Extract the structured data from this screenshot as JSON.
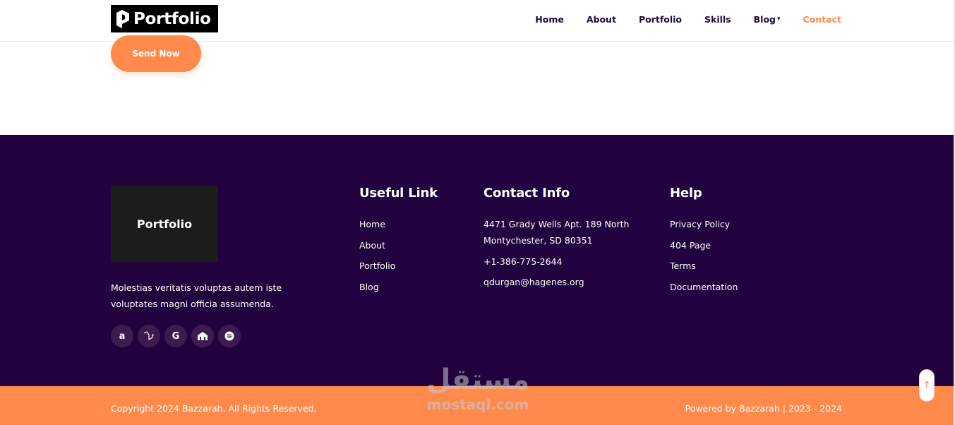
{
  "header": {
    "logo_text": "Portfolio",
    "nav": [
      {
        "label": "Home"
      },
      {
        "label": "About"
      },
      {
        "label": "Portfolio"
      },
      {
        "label": "Skills"
      },
      {
        "label": "Blog"
      },
      {
        "label": "Contact",
        "active": true
      }
    ]
  },
  "form": {
    "send_label": "Send Now"
  },
  "footer": {
    "logo_text": "Portfolio",
    "description": "Molestias veritatis voluptas autem iste voluptates magni officia assumenda.",
    "socials": [
      "amazon-icon",
      "laravel-icon",
      "google-icon",
      "building-icon",
      "spotify-icon"
    ],
    "useful": {
      "title": "Useful Link",
      "items": [
        "Home",
        "About",
        "Portfolio",
        "Blog"
      ]
    },
    "contact": {
      "title": "Contact Info",
      "address": "4471 Grady Wells Apt. 189 North Montychester, SD 80351",
      "phone": "+1-386-775-2644",
      "email": "qdurgan@hagenes.org"
    },
    "help": {
      "title": "Help",
      "items": [
        "Privacy Policy",
        "404 Page",
        "Terms",
        "Documentation"
      ]
    }
  },
  "bottom": {
    "copyright": "Copyright 2024 Bazzarah. All Rights Reserved.",
    "powered": "Powered by Bazzarah | 2023 - 2024"
  },
  "watermark": {
    "arabic": "مستقل",
    "latin": "mostaql.com"
  },
  "colors": {
    "accent": "#ff8a4c",
    "footer_bg": "#22013f",
    "nav_text": "#1e0a3c"
  }
}
